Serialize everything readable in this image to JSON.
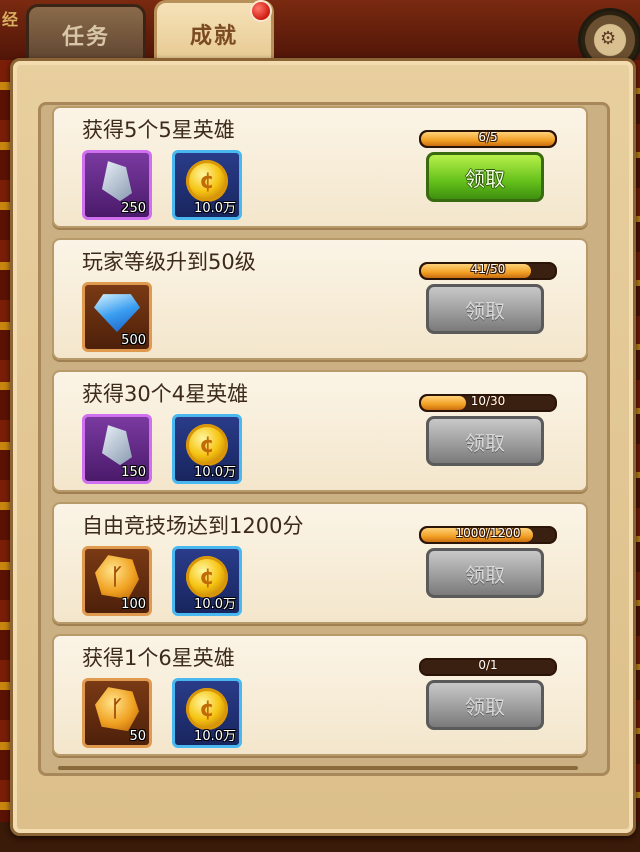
{
  "tabs": [
    {
      "label": "任务",
      "active": false
    },
    {
      "label": "成就",
      "active": true
    }
  ],
  "side_glyph": "经",
  "achievements": [
    {
      "title": "获得5个5星英雄",
      "progress_text": "6/5",
      "progress_fraction": 1.0,
      "claim_label": "领取",
      "claim_enabled": true,
      "rewards": [
        {
          "icon": "stone-icon",
          "frame": "purple",
          "quantity": "250"
        },
        {
          "icon": "coin-icon",
          "frame": "blue",
          "quantity": "10.0万"
        }
      ]
    },
    {
      "title": "玩家等级升到50级",
      "progress_text": "41/50",
      "progress_fraction": 0.82,
      "claim_label": "领取",
      "claim_enabled": false,
      "rewards": [
        {
          "icon": "diamond-icon",
          "frame": "brown",
          "quantity": "500"
        }
      ]
    },
    {
      "title": "获得30个4星英雄",
      "progress_text": "10/30",
      "progress_fraction": 0.333,
      "claim_label": "领取",
      "claim_enabled": false,
      "rewards": [
        {
          "icon": "stone-icon",
          "frame": "purple",
          "quantity": "150"
        },
        {
          "icon": "coin-icon",
          "frame": "blue",
          "quantity": "10.0万"
        }
      ]
    },
    {
      "title": "自由竞技场达到1200分",
      "progress_text": "1000/1200",
      "progress_fraction": 0.833,
      "claim_label": "领取",
      "claim_enabled": false,
      "rewards": [
        {
          "icon": "rock-icon",
          "frame": "brown",
          "quantity": "100"
        },
        {
          "icon": "coin-icon",
          "frame": "blue",
          "quantity": "10.0万"
        }
      ]
    },
    {
      "title": "获得1个6星英雄",
      "progress_text": "0/1",
      "progress_fraction": 0.0,
      "claim_label": "领取",
      "claim_enabled": false,
      "rewards": [
        {
          "icon": "rock-icon",
          "frame": "brown",
          "quantity": "50"
        },
        {
          "icon": "coin-icon",
          "frame": "blue",
          "quantity": "10.0万"
        }
      ]
    }
  ]
}
